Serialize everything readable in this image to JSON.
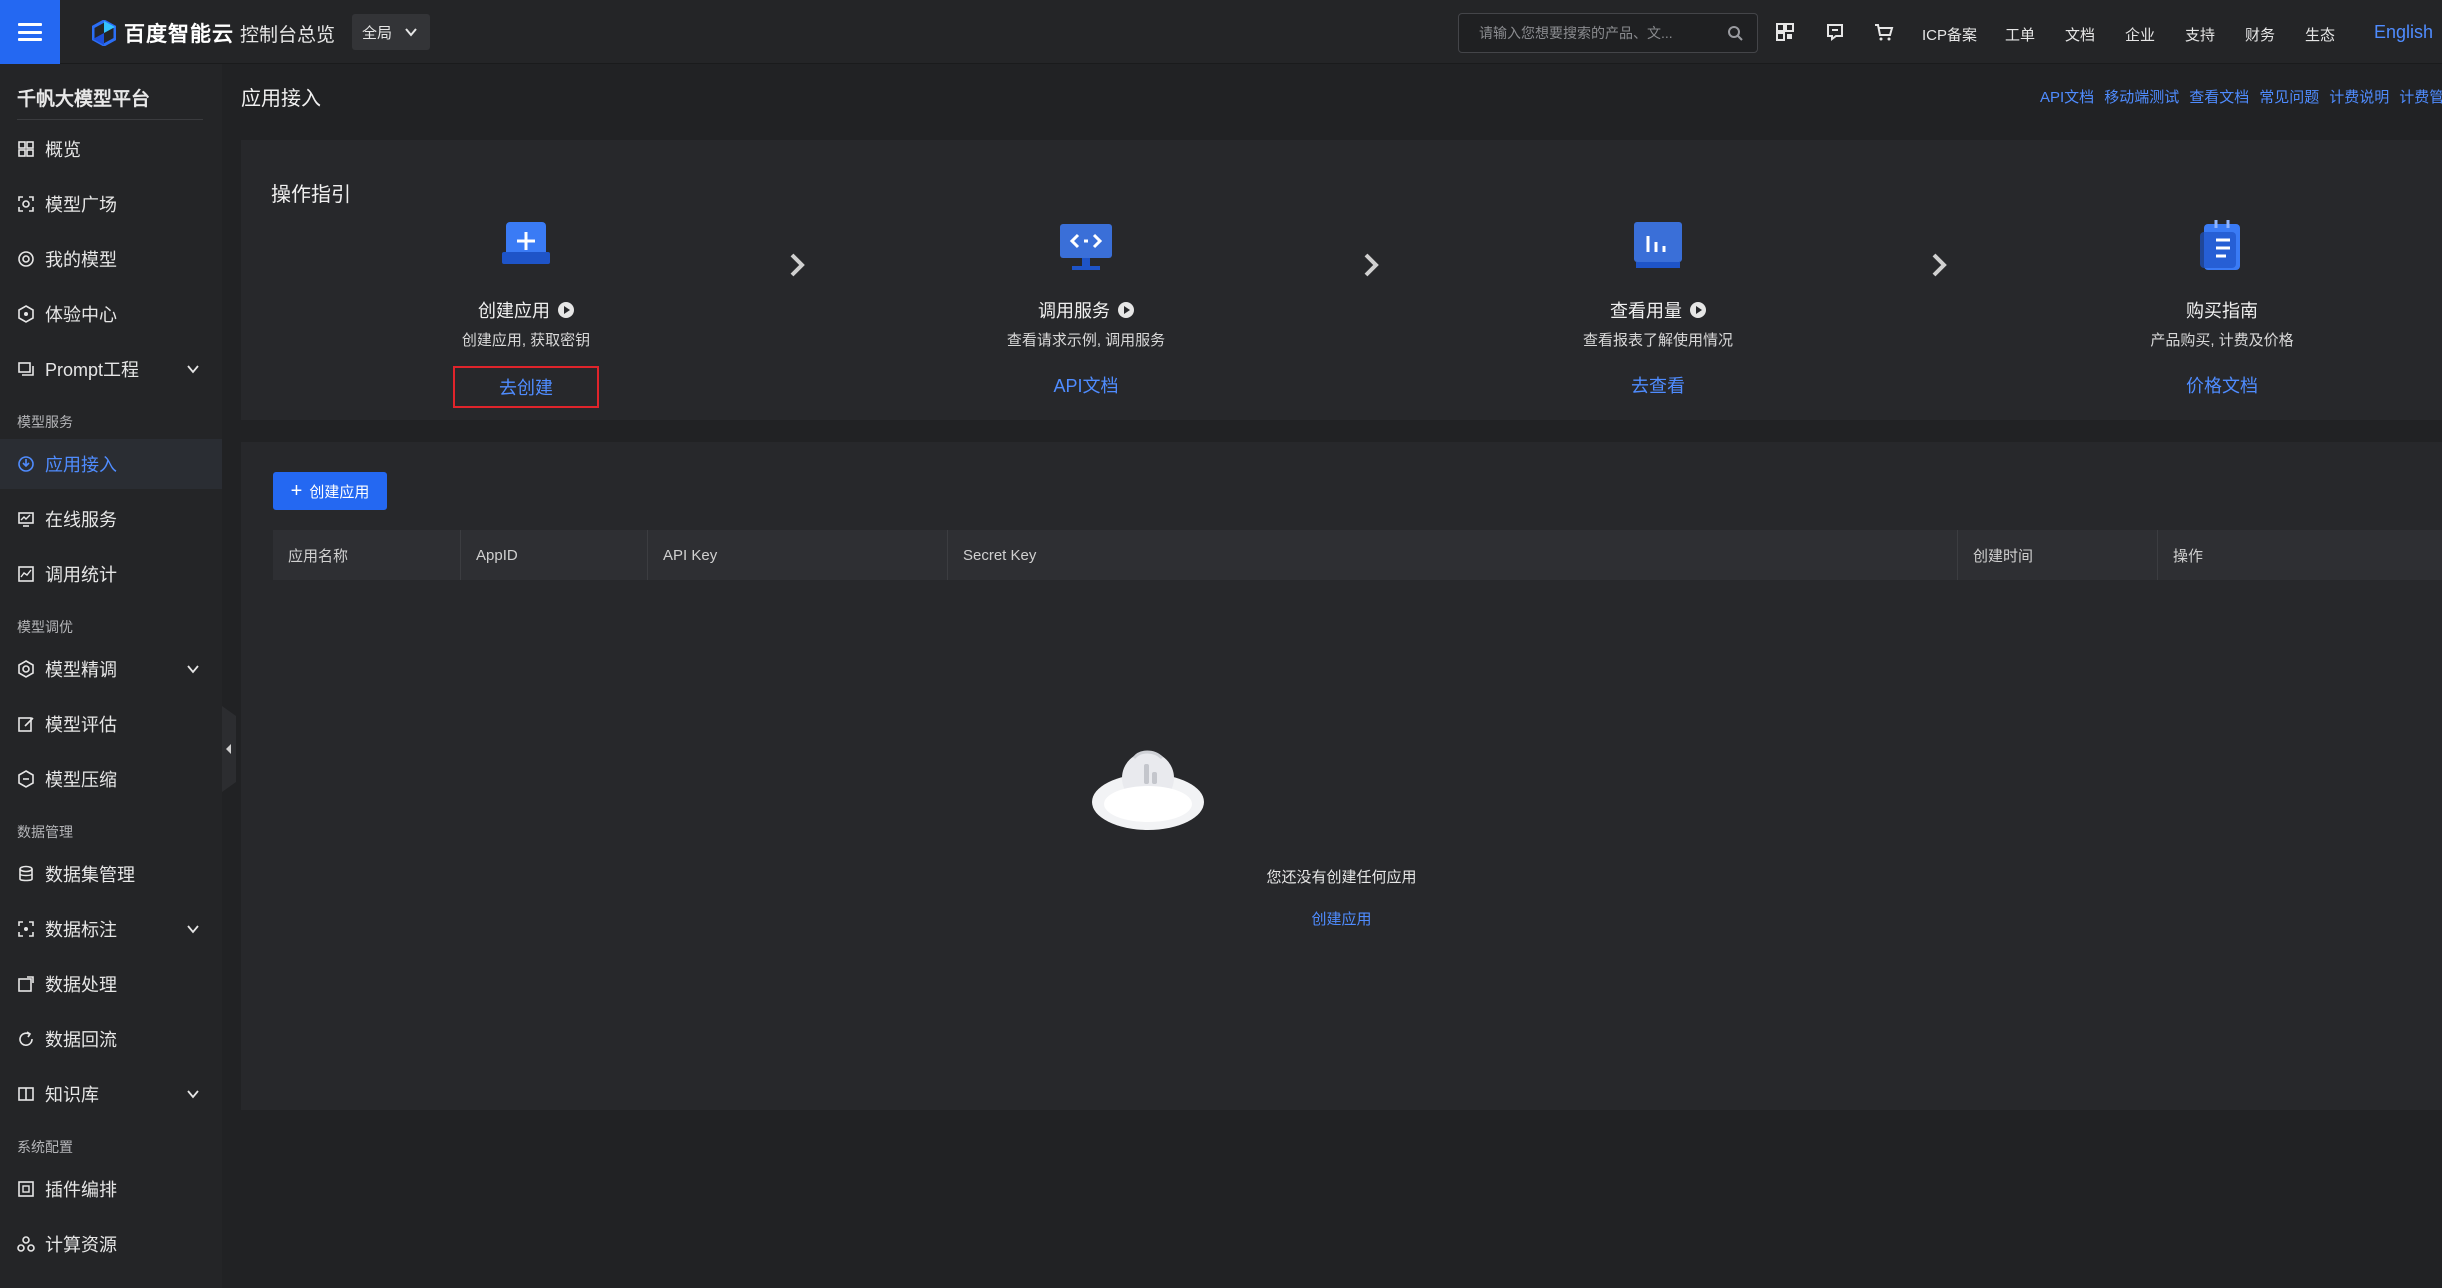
{
  "topbar": {
    "brand": "百度智能云",
    "console": "控制台总览",
    "region": "全局",
    "search_placeholder": "请输入您想要搜索的产品、文...",
    "links": [
      "ICP备案",
      "工单",
      "文档",
      "企业",
      "支持",
      "财务",
      "生态"
    ],
    "language": "English"
  },
  "sidebar": {
    "title": "千帆大模型平台",
    "items": [
      {
        "label": "概览"
      },
      {
        "label": "模型广场"
      },
      {
        "label": "我的模型"
      },
      {
        "label": "体验中心"
      },
      {
        "label": "Prompt工程"
      },
      {
        "label": "应用接入",
        "active": true
      },
      {
        "label": "在线服务"
      },
      {
        "label": "调用统计"
      },
      {
        "label": "模型精调"
      },
      {
        "label": "模型评估"
      },
      {
        "label": "模型压缩"
      },
      {
        "label": "数据集管理"
      },
      {
        "label": "数据标注"
      },
      {
        "label": "数据处理"
      },
      {
        "label": "数据回流"
      },
      {
        "label": "知识库"
      },
      {
        "label": "插件编排"
      },
      {
        "label": "计算资源"
      }
    ],
    "sections": [
      "模型服务",
      "模型调优",
      "数据管理",
      "系统配置"
    ]
  },
  "page": {
    "title": "应用接入",
    "doc_links": [
      "API文档",
      "移动端测试",
      "查看文档",
      "常见问题",
      "计费说明",
      "计费管"
    ]
  },
  "guide": {
    "title": "操作指引",
    "steps": [
      {
        "name": "创建应用",
        "desc": "创建应用, 获取密钥",
        "link": "去创建"
      },
      {
        "name": "调用服务",
        "desc": "查看请求示例, 调用服务",
        "link": "API文档"
      },
      {
        "name": "查看用量",
        "desc": "查看报表了解使用情况",
        "link": "去查看"
      },
      {
        "name": "购买指南",
        "desc": "产品购买, 计费及价格",
        "link": "价格文档"
      }
    ]
  },
  "list": {
    "create_button": "创建应用",
    "columns": [
      "应用名称",
      "AppID",
      "API Key",
      "Secret Key",
      "创建时间",
      "操作"
    ],
    "empty_text": "您还没有创建任何应用",
    "empty_link": "创建应用"
  },
  "colors": {
    "accent": "#2468f2",
    "link": "#4f8cff",
    "highlight_box": "#e0242b"
  }
}
